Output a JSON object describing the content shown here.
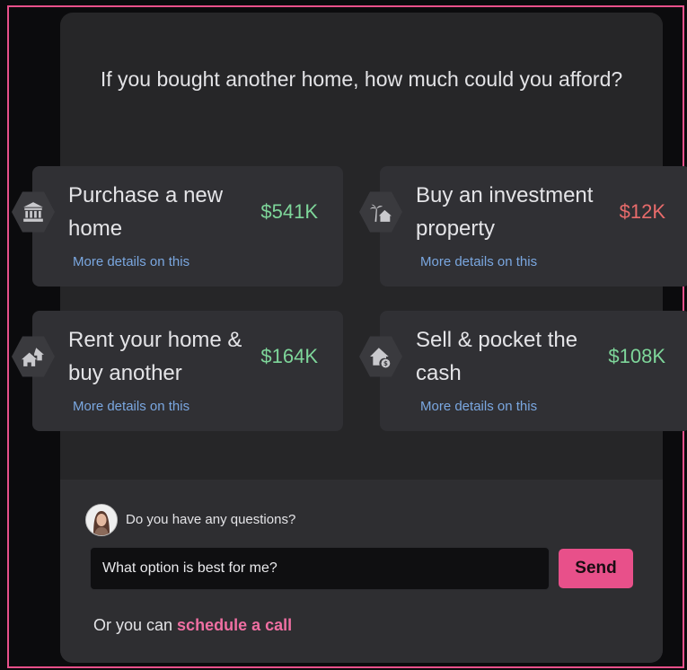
{
  "header": {
    "question": "If you bought another home, how much could you afford?"
  },
  "options": [
    {
      "title": "Purchase a new home",
      "amount": "$541K",
      "link": "More details on this",
      "icon": "bank-building-icon",
      "trend": "positive"
    },
    {
      "title": "Buy an investment property",
      "amount": "$12K",
      "link": "More details on this",
      "icon": "palm-house-icon",
      "trend": "negative"
    },
    {
      "title": "Rent your home & buy another",
      "amount": "$164K",
      "link": "More details on this",
      "icon": "houses-icon",
      "trend": "positive"
    },
    {
      "title": "Sell & pocket the cash",
      "amount": "$108K",
      "link": "More details on this",
      "icon": "house-dollar-icon",
      "trend": "positive"
    }
  ],
  "chat": {
    "prompt": "Do you have any questions?",
    "input_value": "What option is best for me?",
    "send_label": "Send",
    "schedule_prefix": "Or you can ",
    "schedule_link": "schedule a call"
  },
  "colors": {
    "accent": "#e8508a",
    "positive": "#7ed69a",
    "negative": "#e86b6b",
    "link": "#7aa7e0"
  }
}
